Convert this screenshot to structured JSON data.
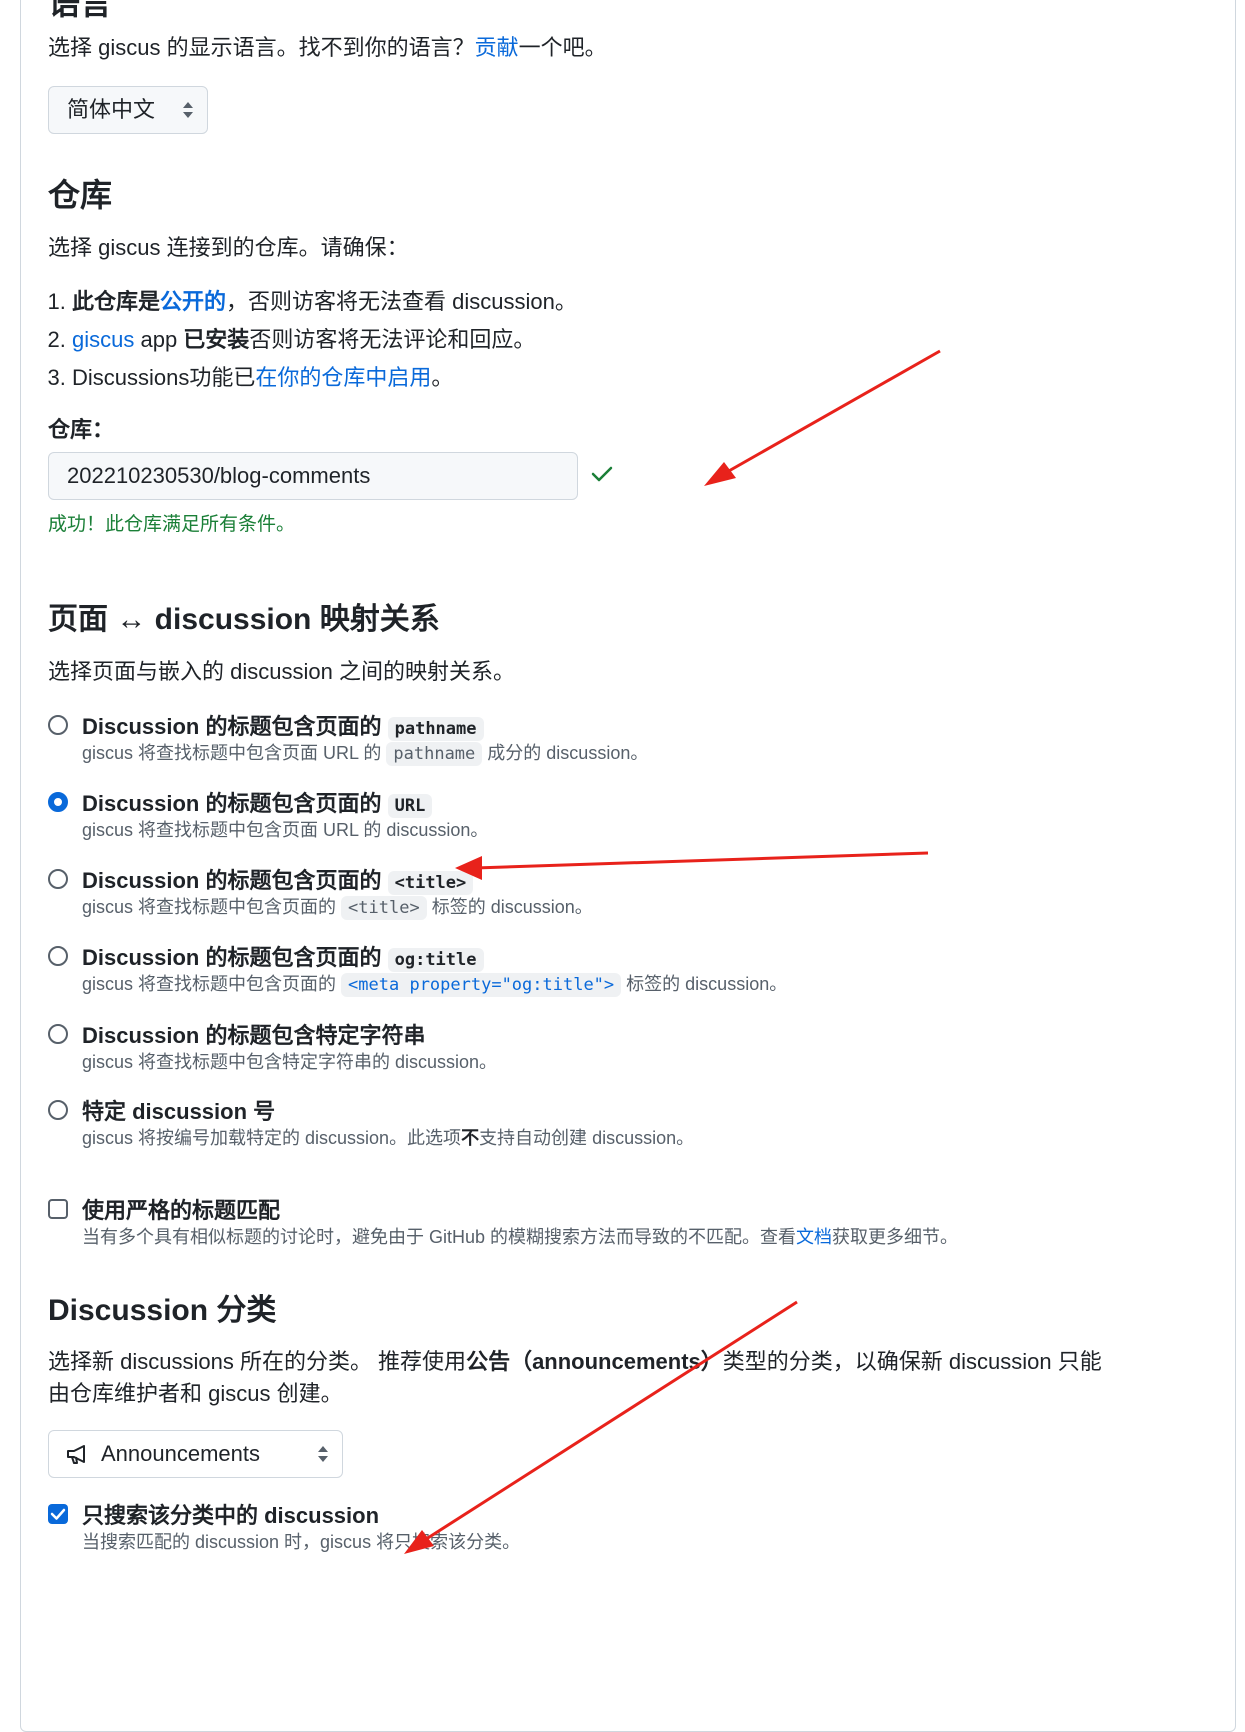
{
  "language": {
    "heading": "语言",
    "desc_before": "选择 giscus 的显示语言。找不到你的语言？",
    "desc_link": "贡献",
    "desc_after": "一个吧。",
    "selected": "简体中文"
  },
  "repository": {
    "heading": "仓库",
    "desc": "选择 giscus 连接到的仓库。请确保：",
    "req1_a": "此仓库是",
    "req1_link": "公开的",
    "req1_b": "，否则访客将无法查看 discussion。",
    "req2_link": "giscus",
    "req2_a": " app ",
    "req2_b": "已安装",
    "req2_c": "否则访客将无法评论和回应。",
    "req3_a": "Discussions功能已",
    "req3_link": "在你的仓库中启用",
    "req3_b": "。",
    "field_label": "仓库：",
    "field_value": "202210230530/blog-comments",
    "success": "成功！此仓库满足所有条件。"
  },
  "mapping": {
    "heading": "页面 ↔ discussion 映射关系",
    "desc": "选择页面与嵌入的 discussion 之间的映射关系。",
    "options": [
      {
        "title": "Discussion 的标题包含页面的",
        "code": "pathname",
        "sub_a": "giscus 将查找标题中包含页面 URL 的",
        "sub_code": "pathname",
        "sub_b": "成分的 discussion。",
        "checked": false
      },
      {
        "title": "Discussion 的标题包含页面的",
        "code": "URL",
        "sub_a": "giscus 将查找标题中包含页面 URL 的 discussion。",
        "checked": true
      },
      {
        "title": "Discussion 的标题包含页面的",
        "code": "<title>",
        "sub_a": "giscus 将查找标题中包含页面的",
        "sub_code": "<title>",
        "sub_b": "标签的 discussion。",
        "checked": false
      },
      {
        "title": "Discussion 的标题包含页面的",
        "code": "og:title",
        "sub_a": "giscus 将查找标题中包含页面的",
        "sub_code": "<meta property=\"og:title\">",
        "sub_b": "标签的 discussion。",
        "checked": false
      },
      {
        "title": "Discussion 的标题包含特定字符串",
        "sub_a": "giscus 将查找标题中包含特定字符串的 discussion。",
        "checked": false
      },
      {
        "title": "特定 discussion 号",
        "sub_a": "giscus 将按编号加载特定的 discussion。此选项",
        "sub_bold": "不",
        "sub_b": "支持自动创建 discussion。",
        "checked": false
      }
    ],
    "strict": {
      "title": "使用严格的标题匹配",
      "sub_a": "当有多个具有相似标题的讨论时，避免由于 GitHub 的模糊搜索方法而导致的不匹配。查看",
      "sub_link": "文档",
      "sub_b": "获取更多细节。",
      "checked": false
    }
  },
  "category": {
    "heading": "Discussion 分类",
    "desc_a": "选择新 discussions 所在的分类。 推荐使用",
    "desc_bold": "公告（announcements）",
    "desc_b": "类型的分类，以确保新 discussion 只能由仓库维护者和 giscus 创建。",
    "selected": "Announcements",
    "only_search": {
      "title": "只搜索该分类中的 discussion",
      "sub": "当搜索匹配的 discussion 时，giscus 将只搜索该分类。",
      "checked": true
    }
  },
  "colors": {
    "link": "#0969da",
    "success": "#1a7f37",
    "annotation_arrow": "#e8221b"
  }
}
